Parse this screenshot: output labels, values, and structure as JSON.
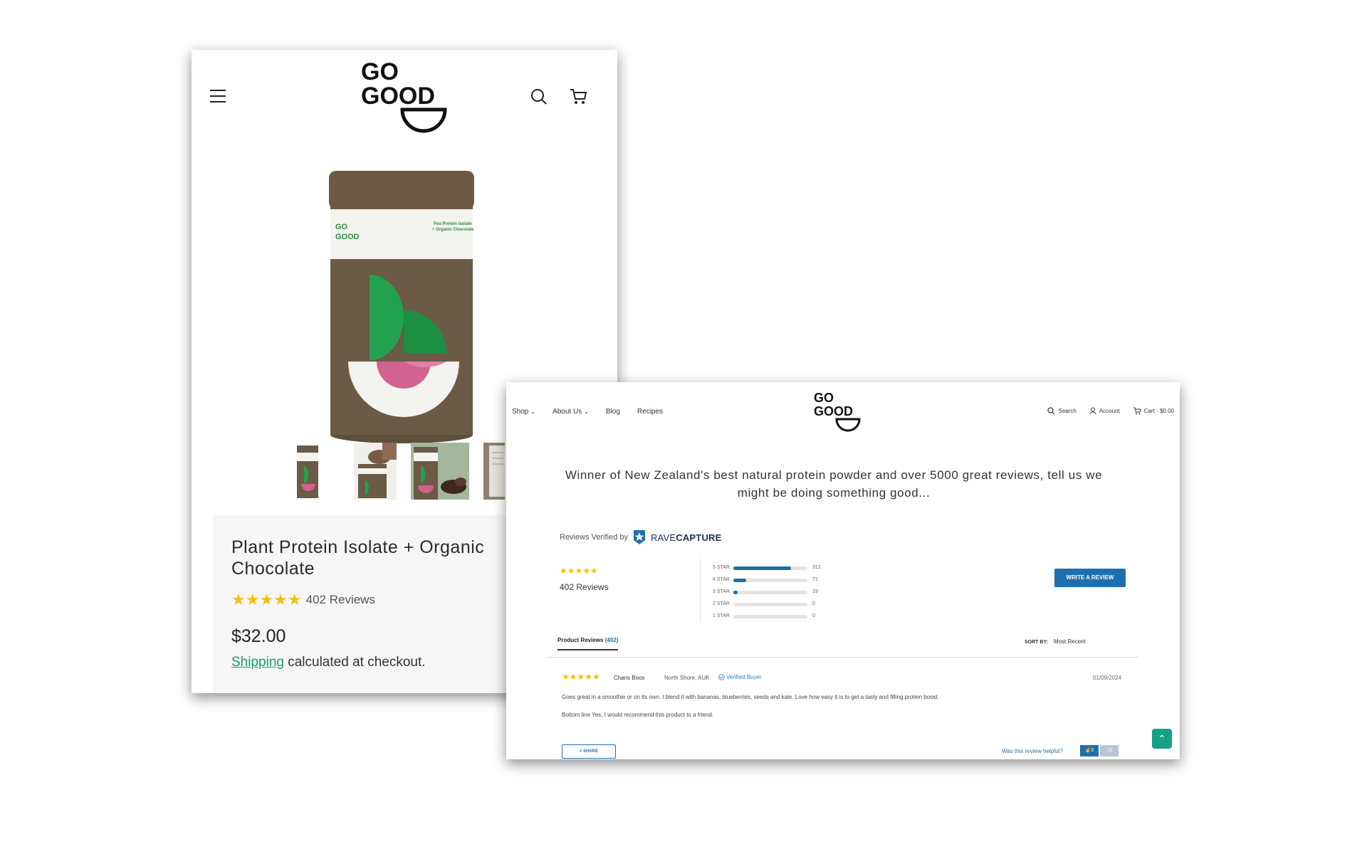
{
  "mobile": {
    "product": {
      "title": "Plant Protein Isolate + Organic Chocolate",
      "stars": "★★★★★",
      "review_count": "402 Reviews",
      "price": "$32.00",
      "shipping_link": "Shipping",
      "shipping_rest": " calculated at checkout."
    },
    "can_label": {
      "line1": "Pea Protein Isolate",
      "line2": "+ Organic Chocolate"
    }
  },
  "desktop": {
    "nav": {
      "shop": "Shop",
      "about": "About Us",
      "blog": "Blog",
      "recipes": "Recipes"
    },
    "right_nav": {
      "search": "Search",
      "account": "Account",
      "cart": "Cart - $0.00"
    },
    "headline": "Winner of New Zealand's best natural protein powder and over 5000 great reviews, tell us we might be doing something good...",
    "verified_by": "Reviews Verified by",
    "rave_a": "RAVE",
    "rave_b": "CAPTURE",
    "summary": {
      "stars": "★★★★★",
      "count": "402 Reviews"
    },
    "histogram": [
      {
        "label": "5 STAR",
        "count": "312",
        "fraction": 0.776
      },
      {
        "label": "4 STAR",
        "count": "71",
        "fraction": 0.177
      },
      {
        "label": "3 STAR",
        "count": "19",
        "fraction": 0.047
      },
      {
        "label": "2 STAR",
        "count": "0",
        "fraction": 0
      },
      {
        "label": "1 STAR",
        "count": "0",
        "fraction": 0
      }
    ],
    "write_review": "WRITE A REVIEW",
    "tab_label": "Product Reviews",
    "tab_count": "(402)",
    "sort_label": "SORT BY:",
    "sort_value": "Most Recent",
    "review": {
      "stars": "★★★★★",
      "author": "Charis Boos",
      "location": "North Shore, AUK",
      "verified": "Verified Buyer",
      "date": "01/09/2024",
      "body": "Goes great in a smoothie or on its own. I blend it with bananas, blueberries, seeds and kale. Love how easy it is to get a tasty and filling protein boost.",
      "bottom_line": "Bottom line Yes, I would recommend this product to a friend.",
      "share": "SHARE",
      "helpful": "Was this review helpful?",
      "up": "0",
      "down": "0"
    }
  },
  "colors": {
    "brand_green": "#1a9b6a",
    "star": "#f4bd17",
    "rave_blue": "#1f6fae",
    "can_brown": "#6b5a46",
    "can_green": "#22a24e",
    "can_pink": "#d2628f"
  }
}
